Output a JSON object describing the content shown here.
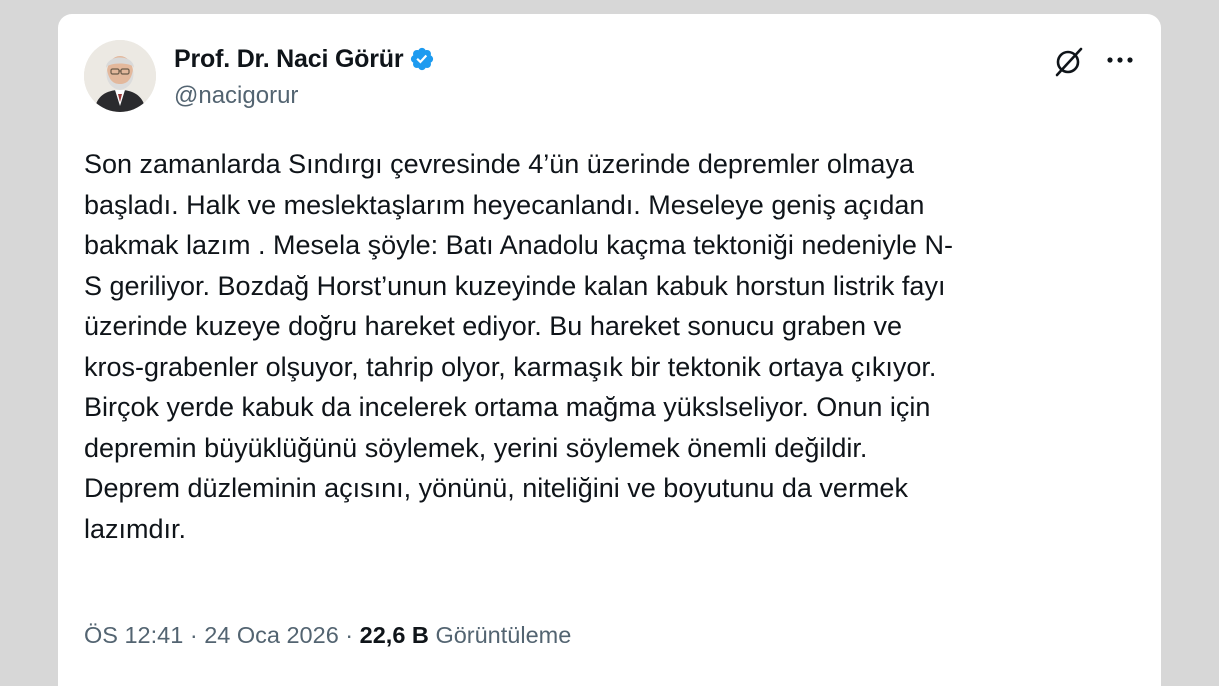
{
  "author": {
    "display_name": "Prof. Dr. Naci Görür",
    "handle": "@nacigorur",
    "verified": true
  },
  "tweet": {
    "text": "Son zamanlarda Sındırgı çevresinde 4’ün üzerinde depremler olmaya\nbaşladı. Halk ve meslektaşlarım heyecanlandı. Meseleye geniş açıdan\nbakmak lazım . Mesela şöyle: Batı Anadolu kaçma tektoniği nedeniyle N-\nS geriliyor. Bozdağ Horst’unun kuzeyinde kalan kabuk horstun listrik fayı\nüzerinde kuzeye doğru hareket ediyor. Bu hareket sonucu graben ve\nkros-grabenler olşuyor, tahrip olyor, karmaşık bir tektonik ortaya çıkıyor.\nBirçok yerde kabuk da incelerek ortama mağma yükslseliyor. Onun için\ndepremin büyüklüğünü söylemek, yerini söylemek önemli değildir.\nDeprem düzleminin açısını, yönünü, niteliğini ve boyutunu da vermek\nlazımdır."
  },
  "meta": {
    "time": "ÖS 12:41",
    "separator": " · ",
    "date": "24 Oca 2026",
    "views_count": "22,6 B",
    "views_label": "Görüntüleme"
  },
  "icons": {
    "verified": "verified-badge-icon",
    "grok": "grok-icon",
    "more": "more-options-icon"
  },
  "colors": {
    "verified_blue": "#1d9bf0",
    "text_primary": "#0f1419",
    "text_secondary": "#536471",
    "page_background": "#d7d7d7",
    "card_background": "#ffffff"
  }
}
